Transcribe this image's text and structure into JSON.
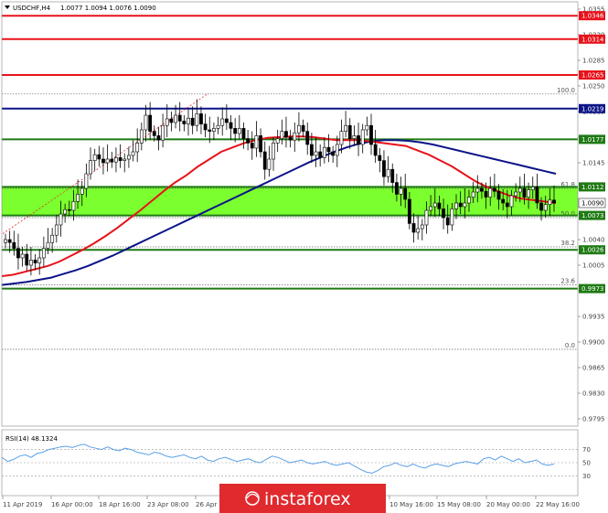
{
  "header": {
    "symbol": "USDCHF,H4",
    "ohlc": "1.0077 1.0094 1.0076 1.0090"
  },
  "watermark": "instaforex",
  "colors": {
    "red_line": "#e8121a",
    "blue_line": "#0b1487",
    "green_line": "#1f7a14",
    "zone_fill": "#7bff2e",
    "ma_fast": "#e8121a",
    "ma_slow": "#0b1487",
    "rsi": "#5aa0e8",
    "candle": "#000000"
  },
  "chart_data": [
    {
      "type": "line",
      "name": "price",
      "ylim": [
        0.9785,
        1.0365
      ],
      "yticks": [
        "1.0355",
        "1.0320",
        "1.0285",
        "1.0250",
        "1.0215",
        "1.0180",
        "1.0145",
        "1.0110",
        "1.0075",
        "1.0040",
        "1.0005",
        "0.9970",
        "0.9935",
        "0.9900",
        "0.9865",
        "0.9830",
        "0.9795"
      ],
      "xticks": [
        "11 Apr 2019",
        "16 Apr 00:00",
        "18 Apr 16:00",
        "23 Apr 08:00",
        "26 Apr 00:00",
        "10 May 16:00",
        "15 May 08:00",
        "20 May 00:00",
        "22 May 16:00"
      ],
      "horizontal_lines": [
        {
          "value": 1.0346,
          "label": "1.0346",
          "style": "red"
        },
        {
          "value": 1.0314,
          "label": "1.0314",
          "style": "red"
        },
        {
          "value": 1.0265,
          "label": "1.0265",
          "style": "red"
        },
        {
          "value": 1.0219,
          "label": "1.0219",
          "style": "blue"
        },
        {
          "value": 1.0177,
          "label": "1.0177",
          "style": "green"
        },
        {
          "value": 1.0112,
          "label": "1.0112",
          "style": "green"
        },
        {
          "value": 1.0073,
          "label": "1.0073",
          "style": "green"
        },
        {
          "value": 1.0026,
          "label": "1.0026",
          "style": "green"
        },
        {
          "value": 0.9973,
          "label": "0.9973",
          "style": "green"
        }
      ],
      "current_price": {
        "value": 1.009,
        "label": "1.0090"
      },
      "support_zone": [
        1.0073,
        1.0112
      ],
      "fibonacci": [
        {
          "value": 1.0239,
          "label": "100.0"
        },
        {
          "value": 1.011,
          "label": "61.8"
        },
        {
          "value": 1.007,
          "label": "50.0"
        },
        {
          "value": 1.003,
          "label": "38.2"
        },
        {
          "value": 0.9978,
          "label": "23.6"
        },
        {
          "value": 0.989,
          "label": "0.0"
        }
      ],
      "closes": [
        1.004,
        1.0036,
        1.0028,
        1.0015,
        1.002,
        1.0005,
        1.0012,
        1.0008,
        1.0015,
        1.0028,
        1.0036,
        1.0046,
        1.006,
        1.0075,
        1.0081,
        1.008,
        1.0092,
        1.0102,
        1.011,
        1.013,
        1.0148,
        1.0156,
        1.015,
        1.0145,
        1.015,
        1.0146,
        1.0152,
        1.0148,
        1.015,
        1.0155,
        1.016,
        1.0172,
        1.019,
        1.021,
        1.0188,
        1.0182,
        1.0176,
        1.0196,
        1.0205,
        1.02,
        1.021,
        1.0202,
        1.0198,
        1.0206,
        1.0196,
        1.0212,
        1.0198,
        1.019,
        1.0188,
        1.0192,
        1.0196,
        1.0205,
        1.02,
        1.0192,
        1.0185,
        1.0192,
        1.0178,
        1.0172,
        1.0165,
        1.0182,
        1.016,
        1.0136,
        1.015,
        1.0172,
        1.0178,
        1.0188,
        1.018,
        1.0176,
        1.0186,
        1.0196,
        1.0188,
        1.017,
        1.0155,
        1.016,
        1.0152,
        1.0166,
        1.016,
        1.0155,
        1.017,
        1.0188,
        1.0196,
        1.0178,
        1.0182,
        1.017,
        1.019,
        1.0196,
        1.017,
        1.0155,
        1.0148,
        1.0126,
        1.0136,
        1.0118,
        1.0102,
        1.011,
        1.0095,
        1.0062,
        1.005,
        1.0055,
        1.006,
        1.008,
        1.0085,
        1.009,
        1.0082,
        1.007,
        1.006,
        1.0082,
        1.009,
        1.0085,
        1.009,
        1.0098,
        1.0105,
        1.011,
        1.0106,
        1.0098,
        1.011,
        1.0106,
        1.0095,
        1.009,
        1.0085,
        1.01,
        1.0105,
        1.011,
        1.0098,
        1.0108,
        1.0112,
        1.009,
        1.008,
        1.0088,
        1.0094,
        1.009
      ],
      "ma_fast": [
        0.999,
        0.9992,
        0.9996,
        1.0,
        1.0004,
        1.001,
        1.0018,
        1.0026,
        1.0035,
        1.0045,
        1.0056,
        1.0068,
        1.008,
        1.0093,
        1.0106,
        1.0118,
        1.0128,
        1.014,
        1.015,
        1.016,
        1.0166,
        1.0172,
        1.0176,
        1.0179,
        1.018,
        1.0181,
        1.0181,
        1.018,
        1.0178,
        1.0176,
        1.0176,
        1.0176,
        1.0174,
        1.0172,
        1.017,
        1.0168,
        1.0162,
        1.0156,
        1.0148,
        1.014,
        1.013,
        1.012,
        1.0112,
        1.0106,
        1.01,
        1.0096,
        1.0094,
        1.0092,
        1.009
      ],
      "ma_slow": [
        0.9978,
        0.998,
        0.9982,
        0.9985,
        0.9988,
        0.9993,
        0.9998,
        1.0004,
        1.0011,
        1.0018,
        1.0026,
        1.0034,
        1.0042,
        1.005,
        1.0058,
        1.0066,
        1.0074,
        1.0082,
        1.009,
        1.0098,
        1.0106,
        1.0114,
        1.0122,
        1.013,
        1.0138,
        1.0146,
        1.0153,
        1.016,
        1.0166,
        1.0171,
        1.0174,
        1.0176,
        1.0176,
        1.0175,
        1.0173,
        1.017,
        1.0166,
        1.0162,
        1.0158,
        1.0154,
        1.015,
        1.0146,
        1.0142,
        1.0138,
        1.0134,
        1.013
      ]
    },
    {
      "type": "line",
      "name": "RSI(14)",
      "title": "RSI(14) 48.1324",
      "ylim": [
        0,
        100
      ],
      "yticks": [
        "70",
        "50",
        "30"
      ],
      "values": [
        58,
        52,
        55,
        60,
        62,
        58,
        64,
        66,
        70,
        72,
        74,
        75,
        73,
        76,
        78,
        74,
        72,
        70,
        74,
        70,
        68,
        72,
        70,
        66,
        64,
        62,
        66,
        64,
        60,
        58,
        60,
        62,
        58,
        56,
        60,
        54,
        52,
        56,
        58,
        55,
        52,
        54,
        56,
        52,
        50,
        55,
        60,
        58,
        54,
        50,
        52,
        54,
        50,
        48,
        50,
        52,
        48,
        46,
        48,
        50,
        45,
        40,
        36,
        34,
        38,
        44,
        46,
        50,
        46,
        44,
        48,
        44,
        42,
        46,
        48,
        46,
        44,
        48,
        50,
        52,
        50,
        48,
        56,
        58,
        54,
        60,
        56,
        52,
        56,
        50,
        52,
        54,
        48,
        46,
        48
      ]
    }
  ]
}
